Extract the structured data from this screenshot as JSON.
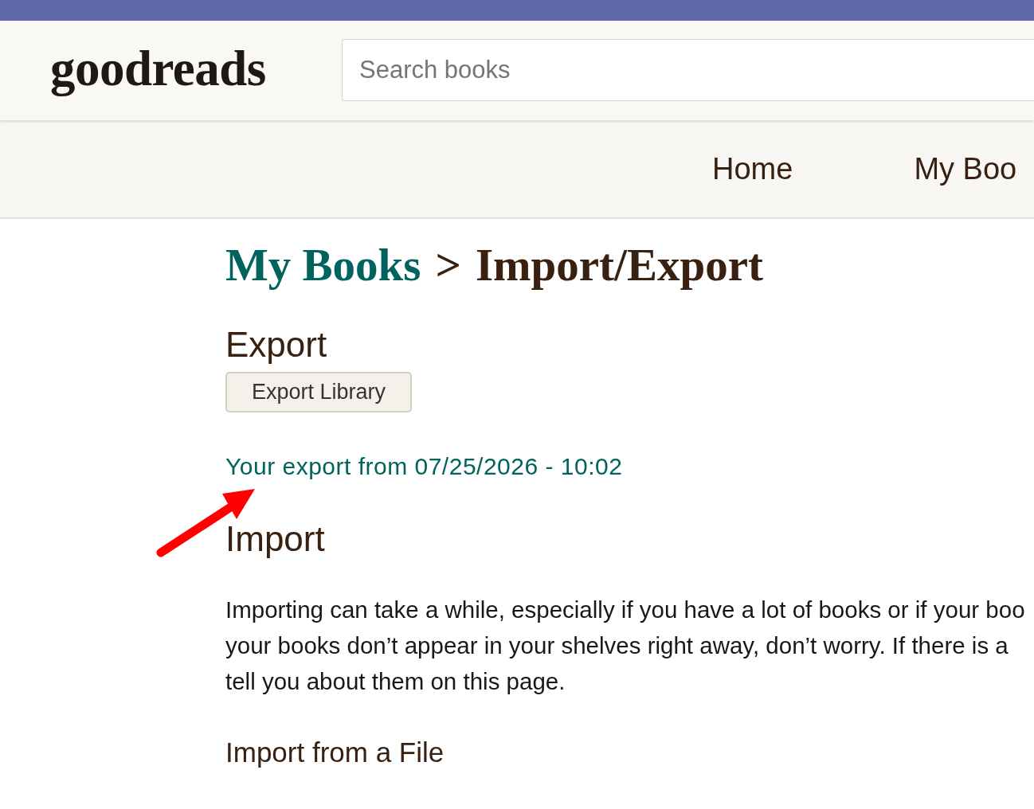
{
  "header": {
    "logo": "goodreads",
    "search": {
      "placeholder": "Search books"
    }
  },
  "nav": {
    "items": [
      {
        "label": "Home"
      },
      {
        "label": "My Boo"
      }
    ]
  },
  "breadcrumb": [
    {
      "label": "My Books",
      "kind": "link"
    },
    {
      "label": ">",
      "kind": "separator"
    },
    {
      "label": "Import/Export",
      "kind": "current"
    }
  ],
  "export": {
    "heading": "Export",
    "button": "Export Library",
    "link": "Your export from 07/25/2026 - 10:02"
  },
  "import": {
    "heading": "Import",
    "text": "Importing can take a while, especially if you have a lot of books or if your boo\nyour books don’t appear in your shelves right away, don’t worry. If there is a\ntell you about them on this page.",
    "subheading": "Import from a File"
  }
}
